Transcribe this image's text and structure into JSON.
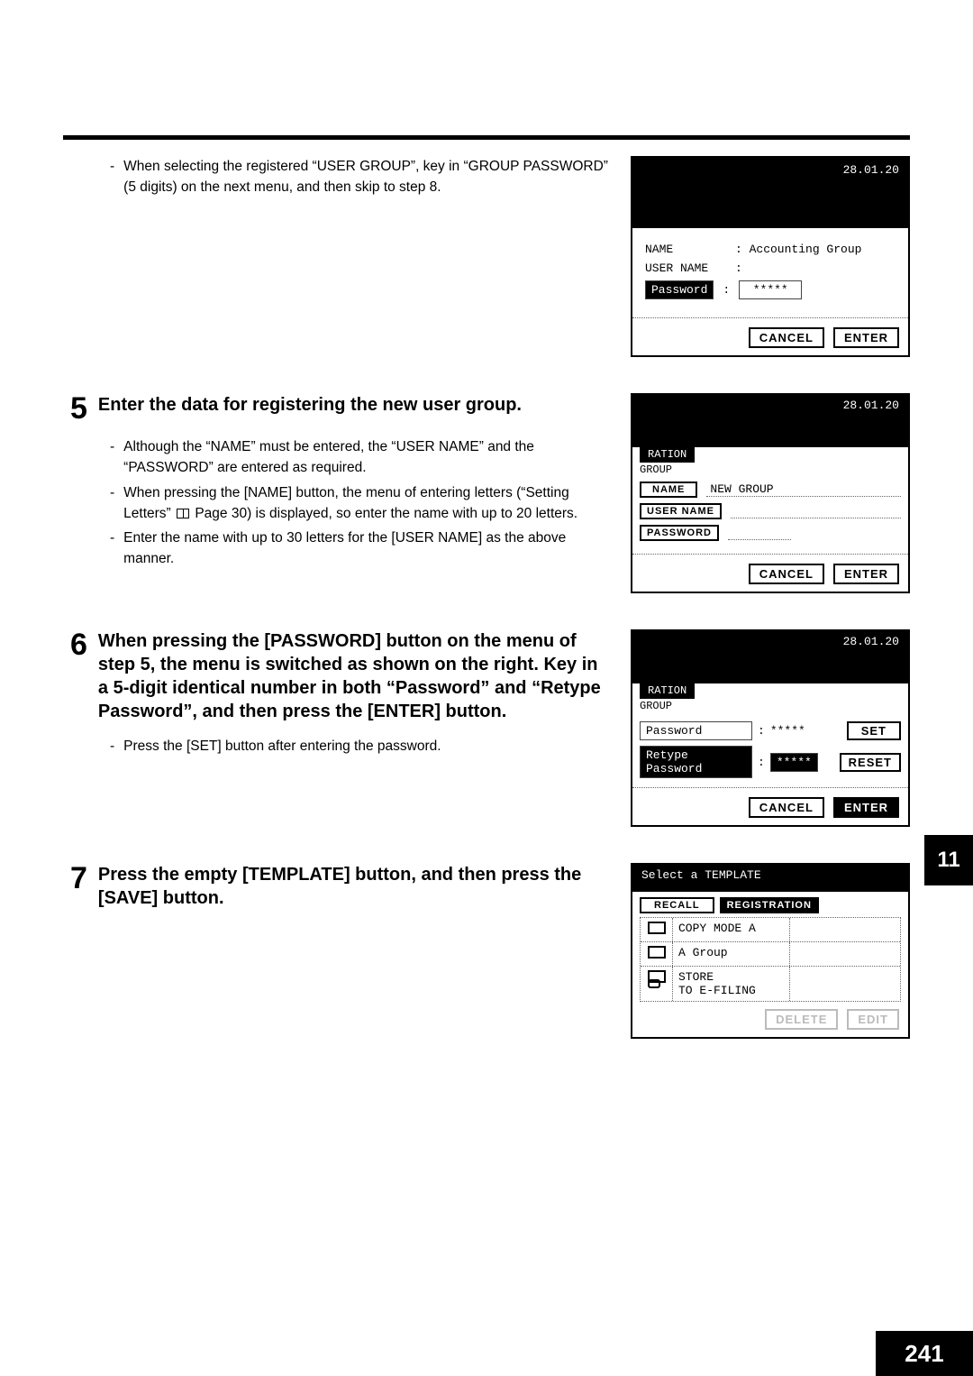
{
  "chapter_tab": "11",
  "page_number": "241",
  "step4": {
    "bullet": "When selecting the registered “USER GROUP”, key in “GROUP PASSWORD” (5 digits) on the next menu, and then skip to step 8.",
    "screen": {
      "date": "28.01.20",
      "name_label": "NAME",
      "name_value": ": Accounting Group",
      "username_label": "USER NAME",
      "username_value": ":",
      "password_label": "Password",
      "password_colon": ":",
      "password_value": "*****",
      "cancel": "CANCEL",
      "enter": "ENTER"
    }
  },
  "step5": {
    "num": "5",
    "title": "Enter the data for registering the new user group.",
    "b1": "Although the “NAME” must be entered, the “USER NAME” and the “PASSWORD” are entered as required.",
    "b2a": "When pressing the [NAME] button, the menu of entering letters (“Setting Letters” ",
    "b2b": " Page 30) is displayed, so enter the name with up to 20 letters.",
    "b3": "Enter the name with up to 30 letters for the [USER NAME] as the above manner.",
    "screen": {
      "date": "28.01.20",
      "tab": "RATION",
      "header": "GROUP",
      "name_btn": "NAME",
      "name_val": "NEW GROUP",
      "username_btn": "USER NAME",
      "password_btn": "PASSWORD",
      "cancel": "CANCEL",
      "enter": "ENTER"
    }
  },
  "step6": {
    "num": "6",
    "title": "When pressing the [PASSWORD] button on the menu of step 5, the menu is switched as shown on the right. Key in a 5-digit identical number in both “Password” and “Retype Password”, and then press the [ENTER] button.",
    "b1": "Press the [SET] button after entering the password.",
    "screen": {
      "date": "28.01.20",
      "tab": "RATION",
      "header": "GROUP",
      "pw_label": "Password",
      "pw_colon": ":",
      "pw_val": "*****",
      "rpw_label": "Retype Password",
      "rpw_colon": ":",
      "rpw_val": "*****",
      "set": "SET",
      "reset": "RESET",
      "cancel": "CANCEL",
      "enter": "ENTER"
    }
  },
  "step7": {
    "num": "7",
    "title": "Press the empty [TEMPLATE] button, and then press the [SAVE] button.",
    "screen": {
      "header": "Select a TEMPLATE",
      "recall": "RECALL",
      "registration": "REGISTRATION",
      "r1": "COPY MODE A",
      "r2": "A Group",
      "r3a": "STORE",
      "r3b": "TO E-FILING",
      "delete": "DELETE",
      "edit": "EDIT"
    }
  }
}
